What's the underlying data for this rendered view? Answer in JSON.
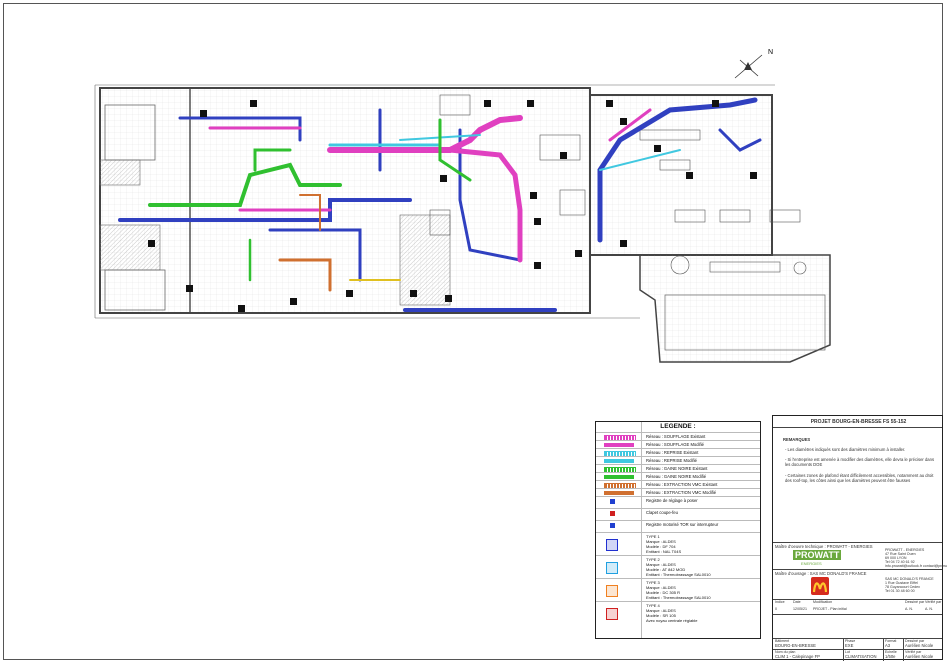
{
  "project": {
    "title": "PROJET BOURG-EN-BRESSE FS 55-152",
    "remarks_heading": "REMARQUES",
    "remarks": [
      "- Les diamètres indiqués sont des diamètres minimum à installer.",
      "- Si l'entreprise est amenée à modifier des diamètres, elle devra le préciser dans les documents DOE",
      "- Certaines zones de plafond étant difficilement accessibles, notamment au droit des roof-top, les côtes ainsi que les diamètres peuvent être fausses"
    ]
  },
  "legend": {
    "heading": "LEGENDE :",
    "items": [
      {
        "label": "Réseau : SOUFFLAGE Existant",
        "color": "#e040c0",
        "style": "hatch"
      },
      {
        "label": "Réseau : SOUFFLAGE Modifié",
        "color": "#e040c0",
        "style": "solid"
      },
      {
        "label": "Réseau : REPRISE Existant",
        "color": "#40c8e0",
        "style": "hatch"
      },
      {
        "label": "Réseau : REPRISE Modifié",
        "color": "#40c8e0",
        "style": "solid"
      },
      {
        "label": "Réseau : GAINE NOIRE Existant",
        "color": "#30c030",
        "style": "hatch"
      },
      {
        "label": "Réseau : GAINE NOIRE Modifié",
        "color": "#30c030",
        "style": "solid"
      },
      {
        "label": "Réseau : EXTRACTION VMC Existant",
        "color": "#d07030",
        "style": "hatch"
      },
      {
        "label": "Réseau : EXTRACTION VMC Modifié",
        "color": "#d07030",
        "style": "solid"
      },
      {
        "label": "Registre de réglage à poser",
        "color": "#2040d0",
        "style": "icon"
      },
      {
        "label": "Clapet coupe-feu",
        "color": "#d02020",
        "style": "icon"
      },
      {
        "label": "Registre motorisé TOR sur interrupteur",
        "color": "#2040d0",
        "style": "icon"
      }
    ],
    "types": [
      {
        "lines": [
          "TYPE 1",
          "Marque : ALDES",
          "Modèle : DF 704",
          "Entitant : NAL T04S"
        ],
        "color": "#2030d0"
      },
      {
        "lines": [
          "TYPE 2",
          "Marque : ALDES",
          "Modèle : AT 842 MOD",
          "Entitant : Thermobrassage SAL0010"
        ],
        "color": "#20a0e0"
      },
      {
        "lines": [
          "TYPE 3",
          "Marque : ALDES",
          "Modèle : DC 305 R",
          "Entitant : Thermobrassage SAL0010"
        ],
        "color": "#f08020"
      },
      {
        "lines": [
          "TYPE 4",
          "Marque : ALDES",
          "Modèle : SR 105",
          "Avec noyau centrale réglable"
        ],
        "color": "#d02020"
      }
    ]
  },
  "cartouche": {
    "maitre_oeuvre_label": "Maître d'oeuvre technique : PROWATT - ENERGIES",
    "company": "PROWATT",
    "company_tag": "ENERGIES",
    "company_address": [
      "PROWATT - ENERGIES",
      "47 Rue Saint Ouen",
      "69 000 LYON",
      "Tel 04 72 40 61 92",
      "info.prowatt@outlook.fr  contact@prowatt.fr"
    ],
    "maitre_ouvrage_label": "Maître d'ouvrage : SAS MC DONALD'S FRANCE",
    "client_address": [
      "SAS MC DONALD'S FRANCE",
      "1 Rue Gustave Eiffel",
      "78 Guyancourt Cedex",
      "Tel 01 30 48 60 00"
    ],
    "rev_headers": [
      "Indice",
      "Date",
      "Modification",
      "Dessiné par",
      "Vérifié par"
    ],
    "rev_row": [
      "0",
      "12/05/21",
      "PROJET - Plan initial",
      "A. N.",
      "A. N."
    ],
    "footer": {
      "site_label": "Bâtiment",
      "site": "BOURG-EN-BRESSE",
      "phase_label": "Phase",
      "phase": "EXE",
      "format_label": "Format",
      "format": "A3",
      "dessine_label": "Dessiné par",
      "dessine": "Aurélien Nicole",
      "nom_label": "Nom du plan",
      "nom": "CLIM 1 - Calepinage FP",
      "lot_label": "Lot",
      "lot": "CLIMATISATION",
      "echelle_label": "Echelle",
      "echelle": "1/50e",
      "verifie_label": "Vérifié par",
      "verifie": "Aurélien Nicole"
    }
  },
  "colors": {
    "supply": "#e040c0",
    "return": "#40c8e0",
    "black_duct": "#30c030",
    "extraction": "#d07030",
    "duct_blue": "#3040c0",
    "walls": "#444444"
  }
}
